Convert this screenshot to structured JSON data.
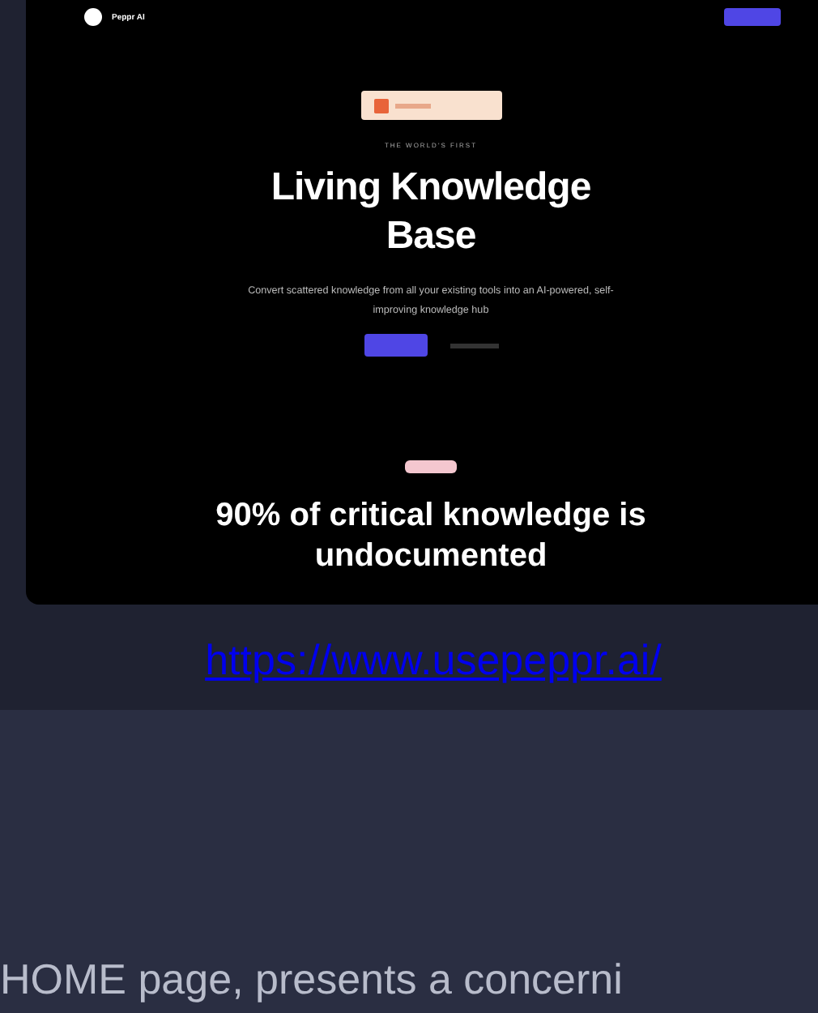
{
  "screenshot": {
    "brand": "Peppr AI",
    "eyebrow": "THE WORLD'S FIRST",
    "title": "Living Knowledge Base",
    "subtitle": "Convert scattered knowledge from all your existing tools into an AI-powered, self-improving knowledge hub",
    "heading": "90% of critical knowledge is undocumented"
  },
  "link": "https://www.usepeppr.ai/",
  "body_text": "HOME page, presents a concerni"
}
